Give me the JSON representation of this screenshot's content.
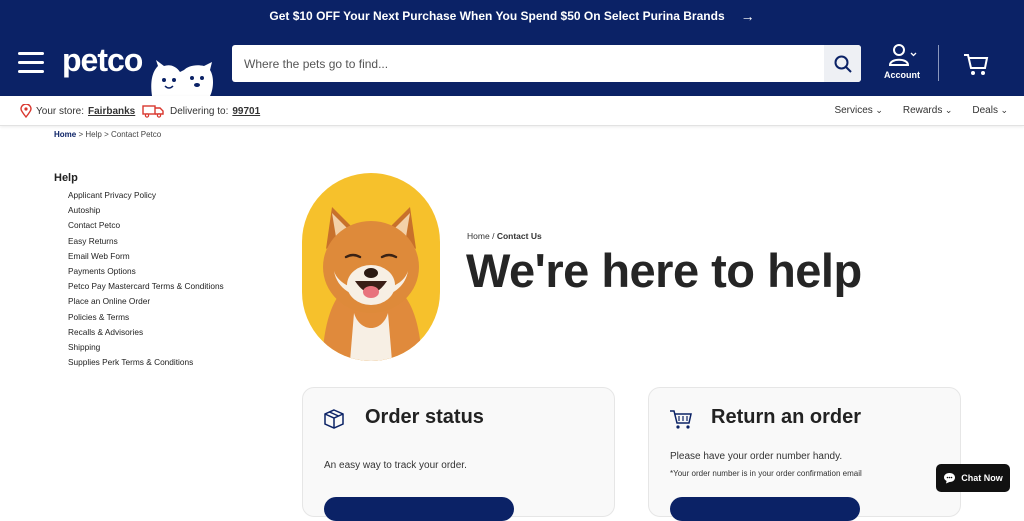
{
  "promo": {
    "text": "Get $10 OFF Your Next Purchase When You Spend $50 On Select Purina Brands",
    "arrow": "→"
  },
  "header": {
    "logo": "petco",
    "search_placeholder": "Where the pets go to find...",
    "account_label": "Account"
  },
  "subbar": {
    "store_prefix": "Your store:",
    "store_name": "Fairbanks",
    "deliver_prefix": "Delivering to:",
    "zip": "99701",
    "nav": [
      "Services",
      "Rewards",
      "Deals"
    ]
  },
  "breadcrumb": {
    "home": "Home",
    "sep": ">",
    "help": "Help",
    "current": "Contact Petco"
  },
  "sidebar": {
    "title": "Help",
    "items": [
      "Applicant Privacy Policy",
      "Autoship",
      "Contact Petco",
      "Easy Returns",
      "Email Web Form",
      "Payments Options",
      "Petco Pay Mastercard Terms & Conditions",
      "Place an Online Order",
      "Policies & Terms",
      "Recalls & Advisories",
      "Shipping",
      "Supplies Perk Terms & Conditions"
    ]
  },
  "hero": {
    "crumb_home": "Home",
    "crumb_sep": "/",
    "crumb_current": "Contact Us",
    "title": "We're here to help"
  },
  "cards": {
    "order": {
      "title": "Order status",
      "text": "An easy way to track your order."
    },
    "return": {
      "title": "Return an order",
      "text": "Please have your order number handy.",
      "note": "*Your order number is in your order confirmation email"
    }
  },
  "chat": {
    "label": "Chat Now"
  },
  "colors": {
    "navy": "#0b2266",
    "hero_bg": "#f6c12c",
    "white": "#ffffff"
  }
}
